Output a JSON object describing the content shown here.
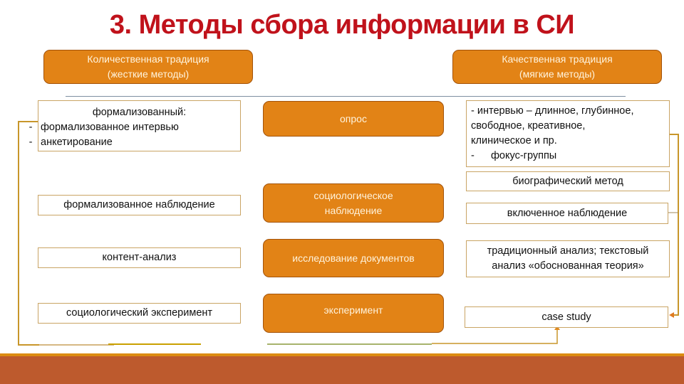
{
  "title": "3. Методы сбора информации в СИ",
  "colors": {
    "title": "#c0121b",
    "orange_box": "#e28316",
    "box_border": "#c9a464",
    "connector": "#c8962a",
    "footer": "#bd5a2d",
    "footer_strip": "#dc8c12"
  },
  "headers": {
    "quantitative": {
      "line1": "Количественная традиция",
      "line2": "(жесткие методы)"
    },
    "qualitative": {
      "line1": "Качественная традиция",
      "line2": "(мягкие методы)"
    }
  },
  "quantitative": {
    "survey": {
      "heading": "формализованный:",
      "items": [
        "формализованное интервью",
        "анкетирование"
      ],
      "bullet": "-"
    },
    "observation": "формализованное наблюдение",
    "documents": "контент-анализ",
    "experiment": "социологический эксперимент"
  },
  "methods": {
    "survey": "опрос",
    "observation": {
      "line1": "социологическое",
      "line2": "наблюдение"
    },
    "documents": "исследование документов",
    "experiment": "эксперимент"
  },
  "qualitative": {
    "survey": {
      "line1": "- интервью – длинное, глубинное,",
      "line2": "свободное, креативное,",
      "line3": "клиническое и пр.",
      "bullet": "-",
      "item": "фокус-группы"
    },
    "biographical": "биографический метод",
    "observation": "включенное наблюдение",
    "documents": {
      "line1": "традиционный анализ; текстовый",
      "line2": "анализ «обоснованная теория»"
    },
    "experiment": "case study"
  }
}
